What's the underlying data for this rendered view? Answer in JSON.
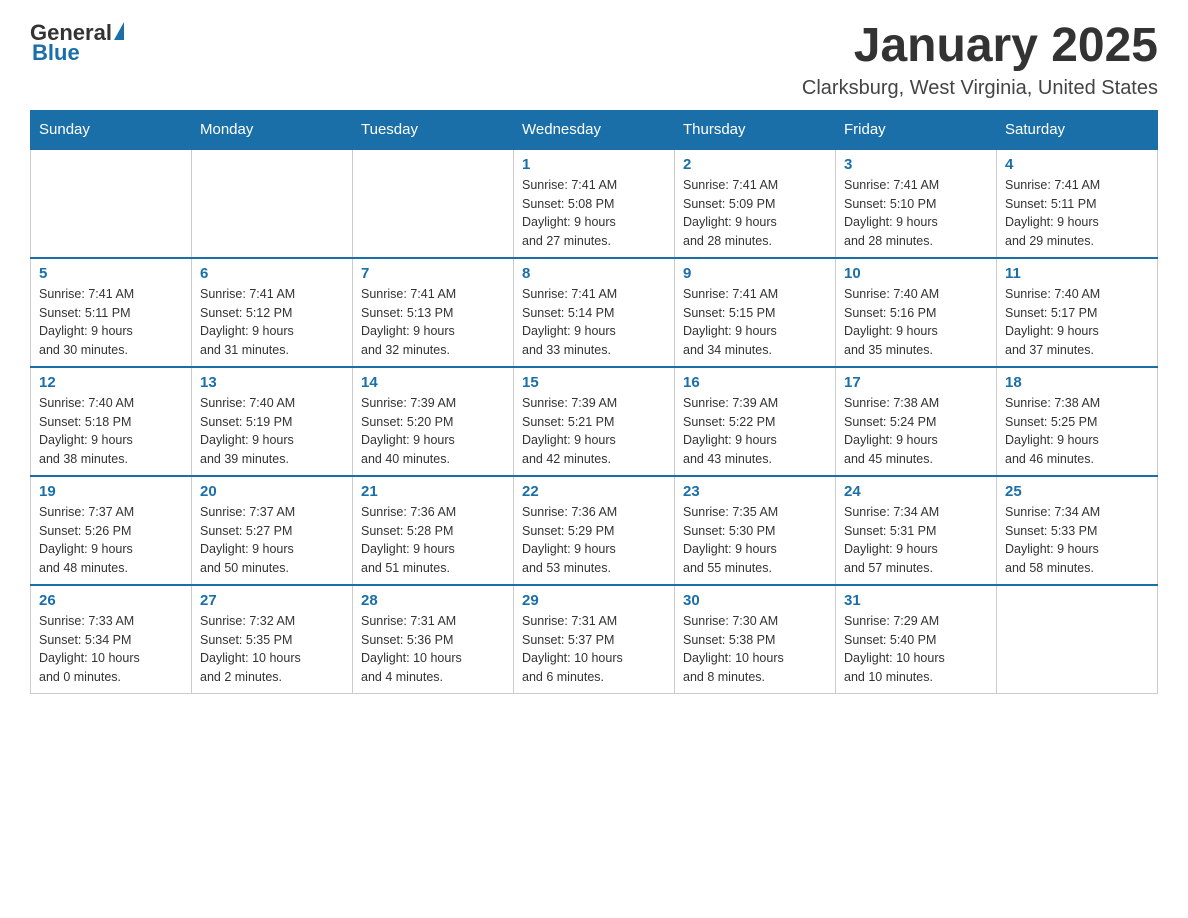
{
  "logo": {
    "general": "General",
    "blue": "Blue"
  },
  "title": "January 2025",
  "location": "Clarksburg, West Virginia, United States",
  "headers": [
    "Sunday",
    "Monday",
    "Tuesday",
    "Wednesday",
    "Thursday",
    "Friday",
    "Saturday"
  ],
  "weeks": [
    [
      {
        "day": "",
        "info": ""
      },
      {
        "day": "",
        "info": ""
      },
      {
        "day": "",
        "info": ""
      },
      {
        "day": "1",
        "info": "Sunrise: 7:41 AM\nSunset: 5:08 PM\nDaylight: 9 hours\nand 27 minutes."
      },
      {
        "day": "2",
        "info": "Sunrise: 7:41 AM\nSunset: 5:09 PM\nDaylight: 9 hours\nand 28 minutes."
      },
      {
        "day": "3",
        "info": "Sunrise: 7:41 AM\nSunset: 5:10 PM\nDaylight: 9 hours\nand 28 minutes."
      },
      {
        "day": "4",
        "info": "Sunrise: 7:41 AM\nSunset: 5:11 PM\nDaylight: 9 hours\nand 29 minutes."
      }
    ],
    [
      {
        "day": "5",
        "info": "Sunrise: 7:41 AM\nSunset: 5:11 PM\nDaylight: 9 hours\nand 30 minutes."
      },
      {
        "day": "6",
        "info": "Sunrise: 7:41 AM\nSunset: 5:12 PM\nDaylight: 9 hours\nand 31 minutes."
      },
      {
        "day": "7",
        "info": "Sunrise: 7:41 AM\nSunset: 5:13 PM\nDaylight: 9 hours\nand 32 minutes."
      },
      {
        "day": "8",
        "info": "Sunrise: 7:41 AM\nSunset: 5:14 PM\nDaylight: 9 hours\nand 33 minutes."
      },
      {
        "day": "9",
        "info": "Sunrise: 7:41 AM\nSunset: 5:15 PM\nDaylight: 9 hours\nand 34 minutes."
      },
      {
        "day": "10",
        "info": "Sunrise: 7:40 AM\nSunset: 5:16 PM\nDaylight: 9 hours\nand 35 minutes."
      },
      {
        "day": "11",
        "info": "Sunrise: 7:40 AM\nSunset: 5:17 PM\nDaylight: 9 hours\nand 37 minutes."
      }
    ],
    [
      {
        "day": "12",
        "info": "Sunrise: 7:40 AM\nSunset: 5:18 PM\nDaylight: 9 hours\nand 38 minutes."
      },
      {
        "day": "13",
        "info": "Sunrise: 7:40 AM\nSunset: 5:19 PM\nDaylight: 9 hours\nand 39 minutes."
      },
      {
        "day": "14",
        "info": "Sunrise: 7:39 AM\nSunset: 5:20 PM\nDaylight: 9 hours\nand 40 minutes."
      },
      {
        "day": "15",
        "info": "Sunrise: 7:39 AM\nSunset: 5:21 PM\nDaylight: 9 hours\nand 42 minutes."
      },
      {
        "day": "16",
        "info": "Sunrise: 7:39 AM\nSunset: 5:22 PM\nDaylight: 9 hours\nand 43 minutes."
      },
      {
        "day": "17",
        "info": "Sunrise: 7:38 AM\nSunset: 5:24 PM\nDaylight: 9 hours\nand 45 minutes."
      },
      {
        "day": "18",
        "info": "Sunrise: 7:38 AM\nSunset: 5:25 PM\nDaylight: 9 hours\nand 46 minutes."
      }
    ],
    [
      {
        "day": "19",
        "info": "Sunrise: 7:37 AM\nSunset: 5:26 PM\nDaylight: 9 hours\nand 48 minutes."
      },
      {
        "day": "20",
        "info": "Sunrise: 7:37 AM\nSunset: 5:27 PM\nDaylight: 9 hours\nand 50 minutes."
      },
      {
        "day": "21",
        "info": "Sunrise: 7:36 AM\nSunset: 5:28 PM\nDaylight: 9 hours\nand 51 minutes."
      },
      {
        "day": "22",
        "info": "Sunrise: 7:36 AM\nSunset: 5:29 PM\nDaylight: 9 hours\nand 53 minutes."
      },
      {
        "day": "23",
        "info": "Sunrise: 7:35 AM\nSunset: 5:30 PM\nDaylight: 9 hours\nand 55 minutes."
      },
      {
        "day": "24",
        "info": "Sunrise: 7:34 AM\nSunset: 5:31 PM\nDaylight: 9 hours\nand 57 minutes."
      },
      {
        "day": "25",
        "info": "Sunrise: 7:34 AM\nSunset: 5:33 PM\nDaylight: 9 hours\nand 58 minutes."
      }
    ],
    [
      {
        "day": "26",
        "info": "Sunrise: 7:33 AM\nSunset: 5:34 PM\nDaylight: 10 hours\nand 0 minutes."
      },
      {
        "day": "27",
        "info": "Sunrise: 7:32 AM\nSunset: 5:35 PM\nDaylight: 10 hours\nand 2 minutes."
      },
      {
        "day": "28",
        "info": "Sunrise: 7:31 AM\nSunset: 5:36 PM\nDaylight: 10 hours\nand 4 minutes."
      },
      {
        "day": "29",
        "info": "Sunrise: 7:31 AM\nSunset: 5:37 PM\nDaylight: 10 hours\nand 6 minutes."
      },
      {
        "day": "30",
        "info": "Sunrise: 7:30 AM\nSunset: 5:38 PM\nDaylight: 10 hours\nand 8 minutes."
      },
      {
        "day": "31",
        "info": "Sunrise: 7:29 AM\nSunset: 5:40 PM\nDaylight: 10 hours\nand 10 minutes."
      },
      {
        "day": "",
        "info": ""
      }
    ]
  ]
}
